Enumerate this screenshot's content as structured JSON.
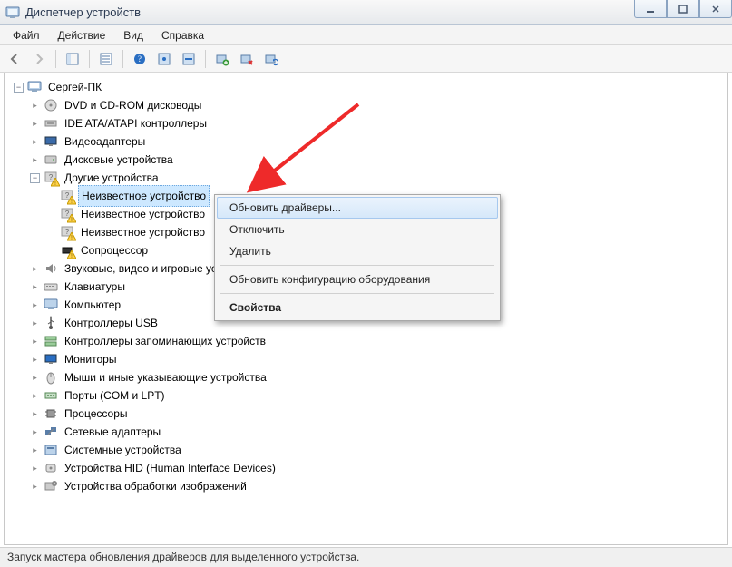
{
  "window": {
    "title": "Диспетчер устройств"
  },
  "menu": {
    "file": "Файл",
    "action": "Действие",
    "view": "Вид",
    "help": "Справка"
  },
  "tree": {
    "root": "Сергей-ПК",
    "categories": [
      "DVD и CD-ROM дисководы",
      "IDE ATA/ATAPI контроллеры",
      "Видеоадаптеры",
      "Дисковые устройства",
      "Другие устройства",
      "Звуковые, видео и игровые устройства",
      "Клавиатуры",
      "Компьютер",
      "Контроллеры USB",
      "Контроллеры запоминающих устройств",
      "Мониторы",
      "Мыши и иные указывающие устройства",
      "Порты (COM и LPT)",
      "Процессоры",
      "Сетевые адаптеры",
      "Системные устройства",
      "Устройства HID (Human Interface Devices)",
      "Устройства обработки изображений"
    ],
    "other_devices": {
      "unknown": "Неизвестное устройство",
      "coproc": "Сопроцессор"
    }
  },
  "context_menu": {
    "update": "Обновить драйверы...",
    "disable": "Отключить",
    "uninstall": "Удалить",
    "scan": "Обновить конфигурацию оборудования",
    "properties": "Свойства"
  },
  "statusbar": "Запуск мастера обновления драйверов для выделенного устройства."
}
